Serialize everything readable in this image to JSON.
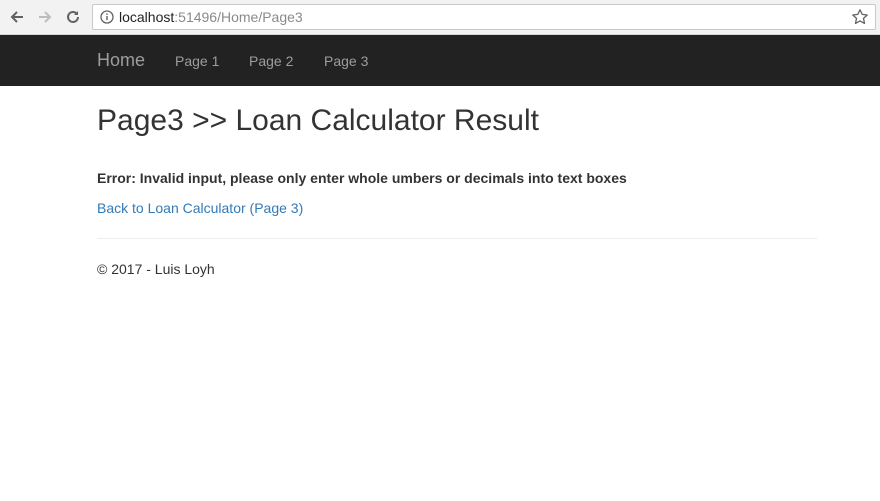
{
  "browser": {
    "url_host": "localhost",
    "url_rest": ":51496/Home/Page3",
    "icons": {
      "back": "arrow-left-icon",
      "forward": "arrow-right-icon",
      "reload": "reload-icon",
      "info": "info-icon",
      "bookmark": "star-icon"
    }
  },
  "navbar": {
    "brand": "Home",
    "links": [
      "Page 1",
      "Page 2",
      "Page 3"
    ]
  },
  "main": {
    "title": "Page3 >> Loan Calculator Result",
    "error": "Error: Invalid input, please only enter whole umbers or decimals into text boxes",
    "back_link": "Back to Loan Calculator (Page 3)"
  },
  "footer": {
    "text": "© 2017 - Luis Loyh"
  },
  "colors": {
    "navbar_bg": "#222222",
    "navbar_text": "#9d9d9d",
    "link": "#337ab7",
    "text": "#333333"
  }
}
